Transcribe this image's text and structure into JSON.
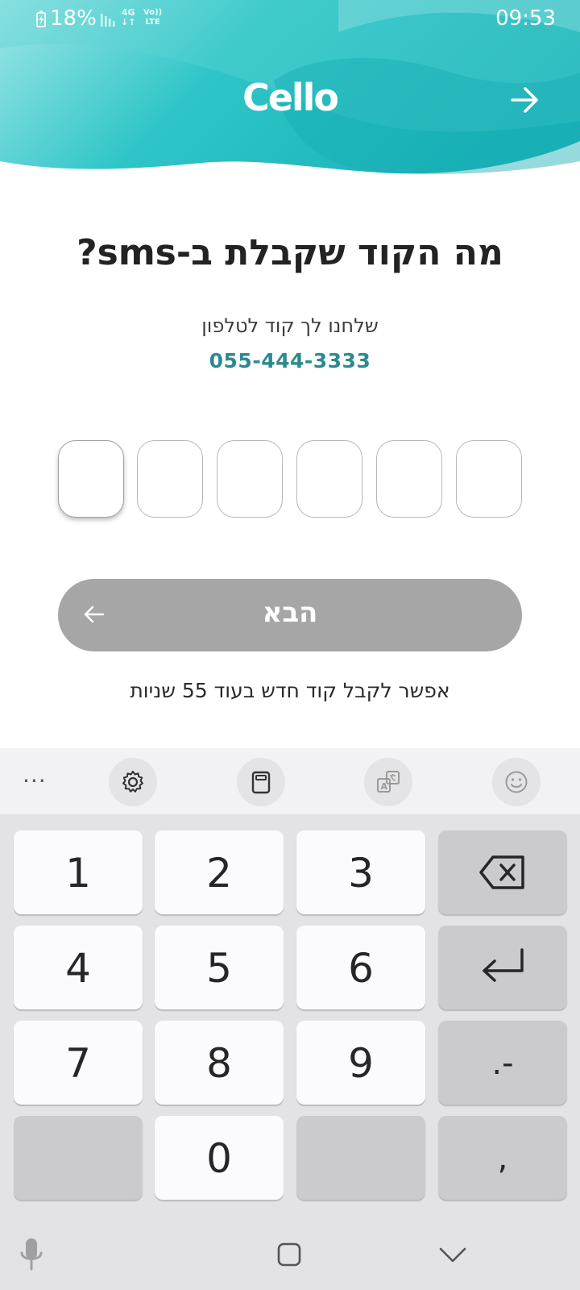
{
  "status_bar": {
    "battery": "18%",
    "network": "4G",
    "volte_line1": "Vo))",
    "volte_line2": "LTE",
    "time": "09:53"
  },
  "header": {
    "logo": "Cello",
    "back_icon": "arrow-right-icon",
    "brand_color": "#2bbfc3"
  },
  "main": {
    "title": "מה הקוד שקבלת ב-sms?",
    "subtitle": "שלחנו לך קוד לטלפון",
    "phone_number": "055-444-3333",
    "code_digits": [
      "",
      "",
      "",
      "",
      "",
      ""
    ],
    "next_button": {
      "label": "הבא",
      "icon": "arrow-left-icon",
      "color": "#a6a6a6"
    },
    "resend_text": "אפשר לקבל קוד חדש בעוד 55 שניות"
  },
  "keyboard": {
    "toolbar": {
      "more": "...",
      "icons": [
        "settings-icon",
        "clipboard-icon",
        "translate-icon",
        "emoji-icon"
      ]
    },
    "keys": {
      "k1": "1",
      "k2": "2",
      "k3": "3",
      "k4": "4",
      "k5": "5",
      "k6": "6",
      "k7": "7",
      "k8": "8",
      "k9": "9",
      "k0": "0",
      "dot_dash": ".-",
      "comma": ","
    },
    "nav_icons": [
      "microphone-icon",
      "home-icon",
      "hide-keyboard-icon"
    ]
  }
}
